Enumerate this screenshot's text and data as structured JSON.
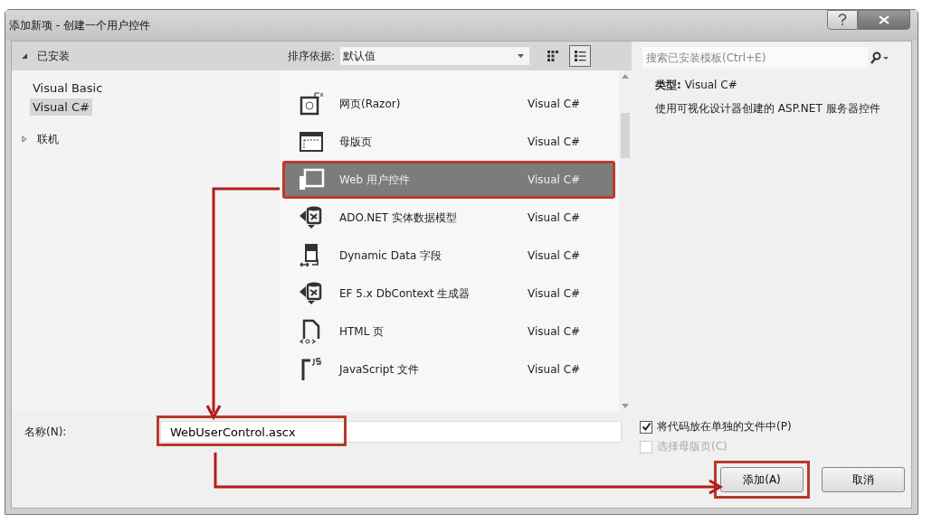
{
  "window": {
    "title": "添加新项 - 创建一个用户控件"
  },
  "sidebar": {
    "items": [
      {
        "label": "已安装",
        "expanded": true,
        "children": [
          {
            "label": "Visual Basic",
            "selected": false
          },
          {
            "label": "Visual C#",
            "selected": true
          }
        ]
      },
      {
        "label": "联机",
        "expanded": false
      }
    ]
  },
  "sort": {
    "label": "排序依据:",
    "value": "默认值"
  },
  "view_toggles": [
    {
      "kind": "grid",
      "selected": false
    },
    {
      "kind": "list",
      "selected": true
    }
  ],
  "search": {
    "placeholder": "搜索已安装模板(Ctrl+E)"
  },
  "templates": [
    {
      "kind": "razor",
      "name": "网页(Razor)",
      "language": "Visual C#",
      "selected": false,
      "annotated": false
    },
    {
      "kind": "master",
      "name": "母版页",
      "language": "Visual C#",
      "selected": false,
      "annotated": false
    },
    {
      "kind": "usercontrol",
      "name": "Web 用户控件",
      "language": "Visual C#",
      "selected": true,
      "annotated": true
    },
    {
      "kind": "entity",
      "name": "ADO.NET 实体数据模型",
      "language": "Visual C#",
      "selected": false,
      "annotated": false
    },
    {
      "kind": "dynamic",
      "name": "Dynamic Data 字段",
      "language": "Visual C#",
      "selected": false,
      "annotated": false
    },
    {
      "kind": "entity",
      "name": "EF 5.x DbContext 生成器",
      "language": "Visual C#",
      "selected": false,
      "annotated": false
    },
    {
      "kind": "html",
      "name": "HTML 页",
      "language": "Visual C#",
      "selected": false,
      "annotated": false
    },
    {
      "kind": "js",
      "name": "JavaScript 文件",
      "language": "Visual C#",
      "selected": false,
      "annotated": false
    }
  ],
  "details": {
    "type": "**类型:** Visual C#",
    "description": "使用可视化设计器创建的 ASP.NET 服务器控件"
  },
  "name_field": {
    "label": "名称(N):",
    "value": "WebUserControl.ascx",
    "annotated": true
  },
  "options": [
    {
      "label": "将代码放在单独的文件中(P)",
      "checked": true,
      "disabled": false
    },
    {
      "label": "选择母版页(C)",
      "checked": false,
      "disabled": true
    }
  ],
  "buttons": [
    {
      "label": "添加(A)",
      "annotated": true
    },
    {
      "label": "取消",
      "annotated": false
    }
  ]
}
